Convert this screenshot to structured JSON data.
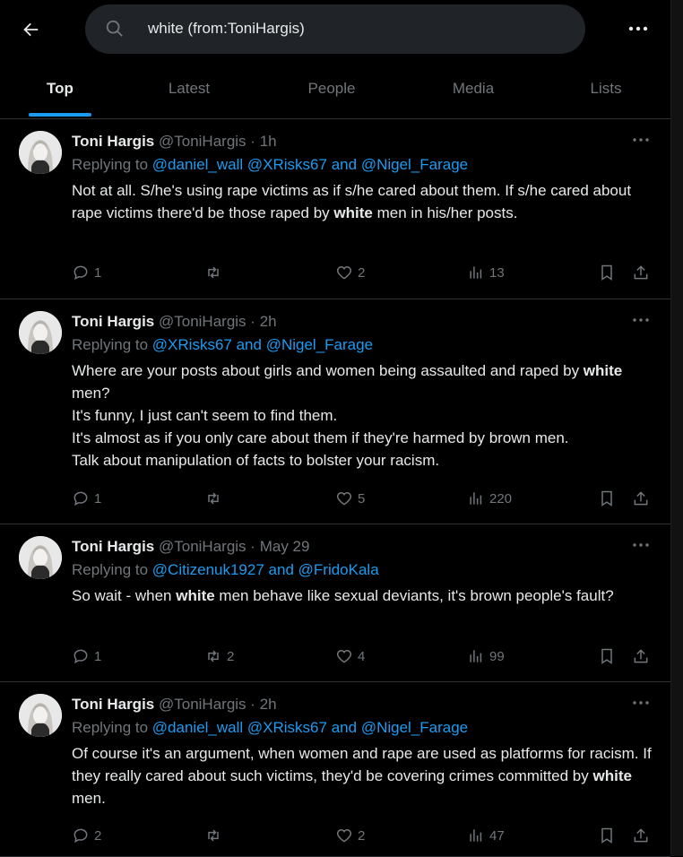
{
  "search": {
    "query": "white (from:ToniHargis)"
  },
  "tabs": [
    "Top",
    "Latest",
    "People",
    "Media",
    "Lists"
  ],
  "tweets": [
    {
      "name": "Toni Hargis",
      "handle": "@ToniHargis",
      "dot": "·",
      "time": "1h",
      "reply_prefix": "Replying to",
      "mentions": [
        "@daniel_wall",
        "@XRisks67",
        "and",
        "@Nigel_Farage"
      ],
      "text_before": "Not at all. S/he's using rape victims as if s/he cared about them. If s/he cared about rape victims there'd be those raped by ",
      "bold": "white",
      "text_after": " men in his/her posts.",
      "replies": "1",
      "reposts": "",
      "likes": "2",
      "views": "13"
    },
    {
      "name": "Toni Hargis",
      "handle": "@ToniHargis",
      "dot": "·",
      "time": "2h",
      "reply_prefix": "Replying to",
      "mentions": [
        "@XRisks67",
        "and",
        "@Nigel_Farage"
      ],
      "text_before": "Where are your posts about girls and women being assaulted and raped by ",
      "bold": "white",
      "text_after": " men?\nIt's funny, I just can't seem to find them.\nIt's almost as if you only care about them if they're harmed by brown men.\nTalk about manipulation of facts to bolster your racism.",
      "replies": "1",
      "reposts": "",
      "likes": "5",
      "views": "220"
    },
    {
      "name": "Toni Hargis",
      "handle": "@ToniHargis",
      "dot": "·",
      "time": "May 29",
      "reply_prefix": "Replying to",
      "mentions": [
        "@Citizenuk1927",
        "and",
        "@FridoKala"
      ],
      "text_before": "So wait - when ",
      "bold": "white",
      "text_after": " men behave like sexual deviants, it's brown people's fault?",
      "replies": "1",
      "reposts": "2",
      "likes": "4",
      "views": "99"
    },
    {
      "name": "Toni Hargis",
      "handle": "@ToniHargis",
      "dot": "·",
      "time": "2h",
      "reply_prefix": "Replying to",
      "mentions": [
        "@daniel_wall",
        "@XRisks67",
        "and",
        "@Nigel_Farage"
      ],
      "text_before": "Of course it's an argument, when women and rape are used as platforms for racism. If they really cared about such victims, they'd be covering crimes committed by ",
      "bold": "white",
      "text_after": " men.",
      "replies": "2",
      "reposts": "",
      "likes": "2",
      "views": "47"
    }
  ],
  "icons": {
    "back": "back-arrow-icon",
    "search": "search-icon",
    "more": "more-icon",
    "reply": "reply-icon",
    "repost": "repost-icon",
    "like": "heart-icon",
    "views": "views-icon",
    "bookmark": "bookmark-icon",
    "share": "share-icon"
  },
  "colors": {
    "accent": "#1d9bf0",
    "muted": "#71767b",
    "text": "#e7e9ea",
    "background": "#000000"
  }
}
